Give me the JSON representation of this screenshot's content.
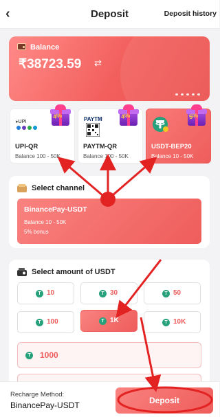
{
  "header": {
    "title": "Deposit",
    "history_label": "Deposit history",
    "back_glyph": "‹"
  },
  "balance": {
    "label": "Balance",
    "amount": "₹38723.59",
    "refresh_glyph": "⇄"
  },
  "methods": [
    {
      "name": "UPI-QR",
      "balance": "Balance 100 - 50K",
      "bonus": "4%",
      "logo": "upi-logo",
      "selected": false
    },
    {
      "name": "PAYTM-QR",
      "balance": "Balance 100 - 50K",
      "bonus": "4%",
      "logo": "paytm-logo",
      "logo_text": "PAYTM",
      "selected": false
    },
    {
      "name": "USDT-BEP20",
      "balance": "Balance 10 - 50K",
      "bonus": "5%",
      "logo": "tether-logo",
      "selected": true
    }
  ],
  "channel": {
    "title": "Select channel",
    "option": {
      "name": "BinancePay-USDT",
      "range": "Balance 10 - 50K",
      "bonus": "5% bonus"
    }
  },
  "amount": {
    "title": "Select amount of USDT",
    "options": [
      "10",
      "30",
      "50",
      "100",
      "1K",
      "10K"
    ],
    "selected": "1K",
    "input_value": "1000"
  },
  "footer": {
    "method_label": "Recharge Method:",
    "method_value": "BinancePay-USDT",
    "deposit_label": "Deposit"
  },
  "colors": {
    "accent": "#ee5d5b",
    "annotation": "#e32222",
    "tether": "#26a17b"
  }
}
